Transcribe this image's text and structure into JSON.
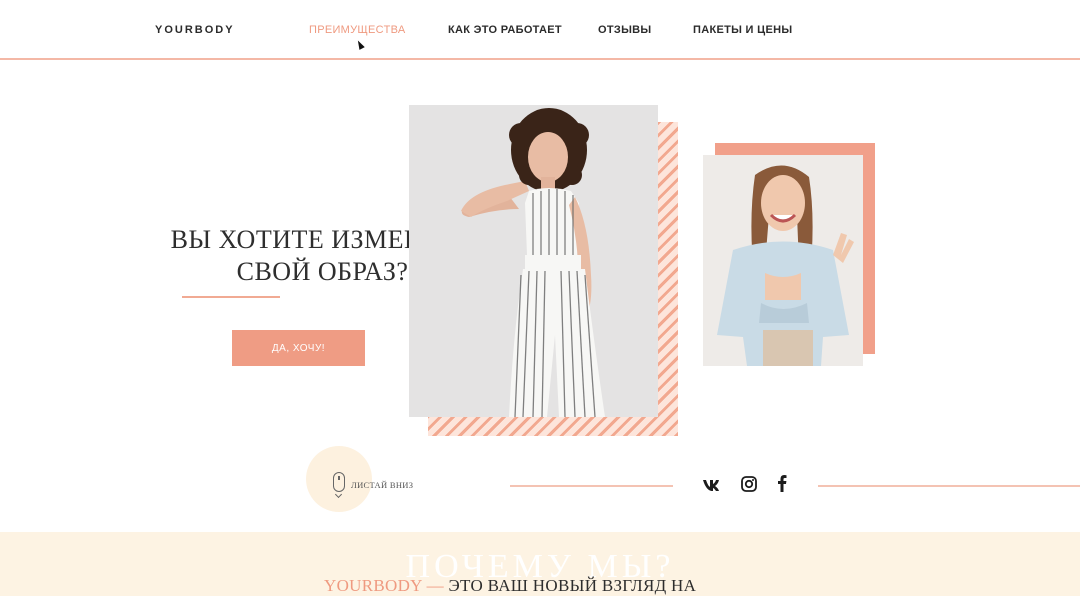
{
  "header": {
    "logo": "YOURBODY",
    "nav": [
      {
        "label": "ПРЕИМУЩЕСТВА",
        "active": true
      },
      {
        "label": "КАК ЭТО РАБОТАЕТ",
        "active": false
      },
      {
        "label": "ОТЗЫВЫ",
        "active": false
      },
      {
        "label": "ПАКЕТЫ И ЦЕНЫ",
        "active": false
      }
    ]
  },
  "hero": {
    "title_line1": "ВЫ ХОТИТЕ ИЗМЕНИТЬ",
    "title_line2": "СВОЙ ОБРАЗ?",
    "cta_label": "ДА, ХОЧУ!"
  },
  "scroll": {
    "label": "ЛИСТАЙ ВНИЗ"
  },
  "social": [
    "vk-icon",
    "instagram-icon",
    "facebook-icon"
  ],
  "section2": {
    "title": "ПОЧЕМУ МЫ?",
    "brand": "YOURBODY —",
    "text": "ЭТО ВАШ НОВЫЙ ВЗГЛЯД НА"
  },
  "colors": {
    "accent": "#ef9c84",
    "accent_light": "#fde5db",
    "section_bg": "#fdf3e3",
    "text_dark": "#2b2b2b"
  }
}
